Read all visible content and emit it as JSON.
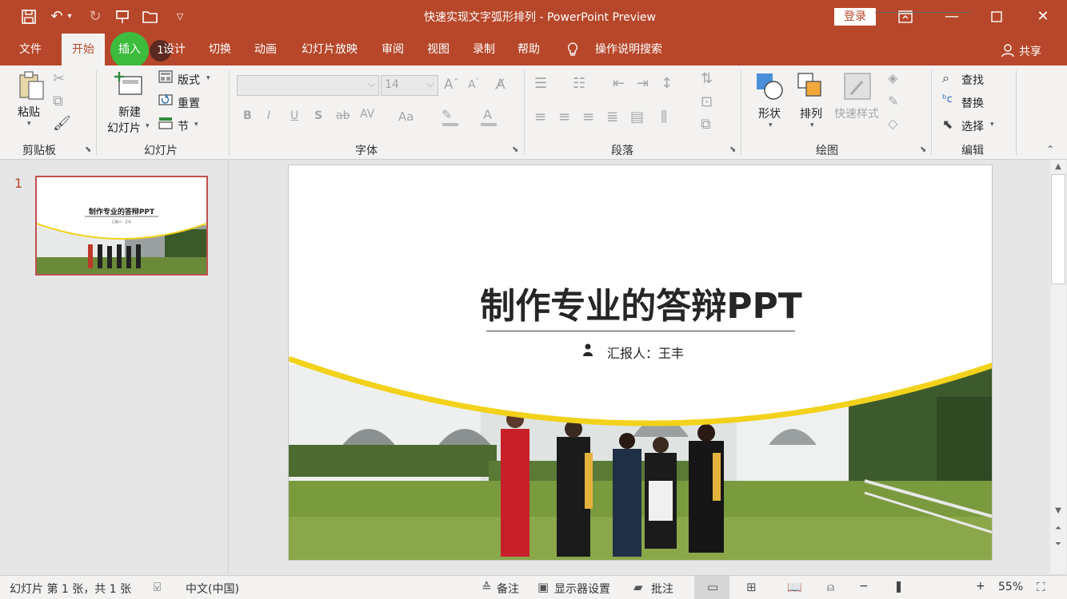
{
  "titlebar": {
    "doc_title": "快速实现文字弧形排列  -  PowerPoint Preview",
    "login": "登录",
    "icons": [
      "save-icon",
      "undo-icon",
      "redo-icon",
      "present-icon",
      "open-icon",
      "customize-icon"
    ]
  },
  "tabs": [
    {
      "label": "文件"
    },
    {
      "label": "开始"
    },
    {
      "label": "插入"
    },
    {
      "label": "设计"
    },
    {
      "label": "切换"
    },
    {
      "label": "动画"
    },
    {
      "label": "幻灯片放映"
    },
    {
      "label": "审阅"
    },
    {
      "label": "视图"
    },
    {
      "label": "录制"
    },
    {
      "label": "帮助"
    },
    {
      "label": "操作说明搜索"
    }
  ],
  "step_badge": "1",
  "share": "共享",
  "ribbon": {
    "clipboard": {
      "paste": "粘贴",
      "label": "剪贴板"
    },
    "slides": {
      "new_slide_1": "新建",
      "new_slide_2": "幻灯片",
      "layout": "版式",
      "reset": "重置",
      "section": "节",
      "label": "幻灯片"
    },
    "font": {
      "size": "14",
      "label": "字体",
      "bold": "B",
      "italic": "I",
      "underline": "U",
      "shadow": "S",
      "strike": "ab",
      "spacing": "AV",
      "case": "Aa",
      "grow": "A",
      "shrink": "A",
      "color": "A"
    },
    "paragraph": {
      "label": "段落"
    },
    "drawing": {
      "shapes": "形状",
      "arrange": "排列",
      "quick_styles": "快速样式",
      "label": "绘图"
    },
    "editing": {
      "find": "查找",
      "replace": "替换",
      "select": "选择",
      "label": "编辑"
    }
  },
  "thumbnail": {
    "number": "1",
    "title": "制作专业的答辩PPT",
    "sub": "汇报人：王丰"
  },
  "slide": {
    "title": "制作专业的答辩PPT",
    "presenter": "汇报人：王丰"
  },
  "status": {
    "slide_info": "幻灯片 第 1 张，共 1 张",
    "language": "中文(中国)",
    "notes": "备注",
    "display": "显示器设置",
    "comments": "批注",
    "zoom": "55%",
    "zoom_minus": "−",
    "zoom_plus": "+"
  },
  "colors": {
    "accent": "#b7472a",
    "highlight": "#3dbb3d",
    "curve": "#f2d21b"
  }
}
